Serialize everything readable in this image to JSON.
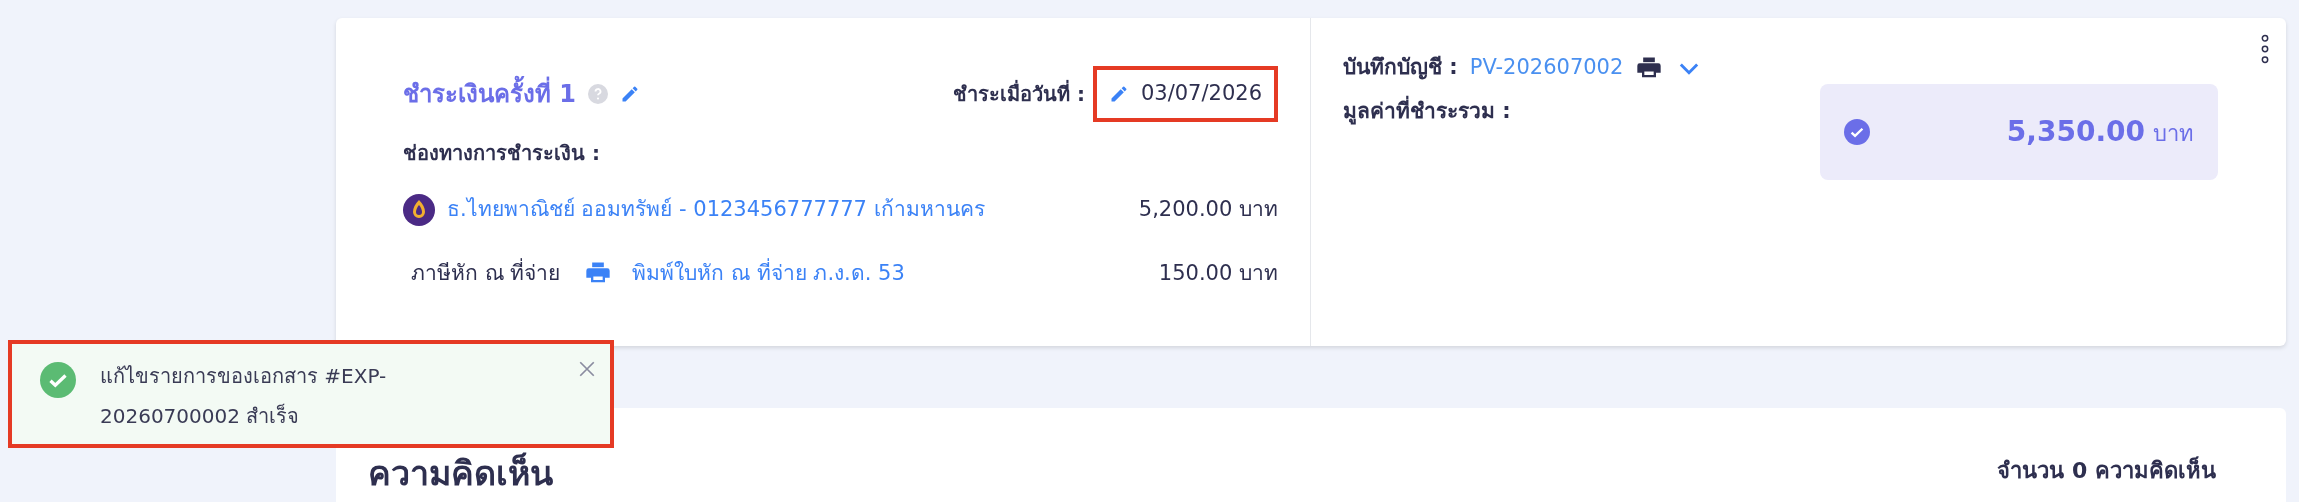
{
  "payment": {
    "title": "ชำระเงินครั้งที่ 1",
    "date_label": "ชำระเมื่อวันที่ :",
    "date": "03/07/2026",
    "date_highlighted": true,
    "channel_label": "ช่องทางการชำระเงิน :",
    "lines": [
      {
        "kind": "bank",
        "label": "ธ.ไทยพาณิชย์ ออมทรัพย์ - 0123456777777 เก้ามหานคร",
        "amount": "5,200.00 บาท"
      },
      {
        "kind": "withholding",
        "label": "ภาษีหัก ณ ที่จ่าย",
        "link": "พิมพ์ใบหัก ณ ที่จ่าย ภ.ง.ด. 53",
        "amount": "150.00 บาท"
      }
    ]
  },
  "journal": {
    "label": "บันทึกบัญชี :",
    "doc": "PV-202607002",
    "total_label": "มูลค่าที่ชำระรวม :",
    "total": "5,350.00",
    "unit": "บาท"
  },
  "comments": {
    "title": "ความคิดเห็น",
    "count": "จำนวน 0 ความคิดเห็น"
  },
  "toast": {
    "message": "แก้ไขรายการของเอกสาร #EXP-20260700002 สำเร็จ",
    "highlighted": true
  }
}
